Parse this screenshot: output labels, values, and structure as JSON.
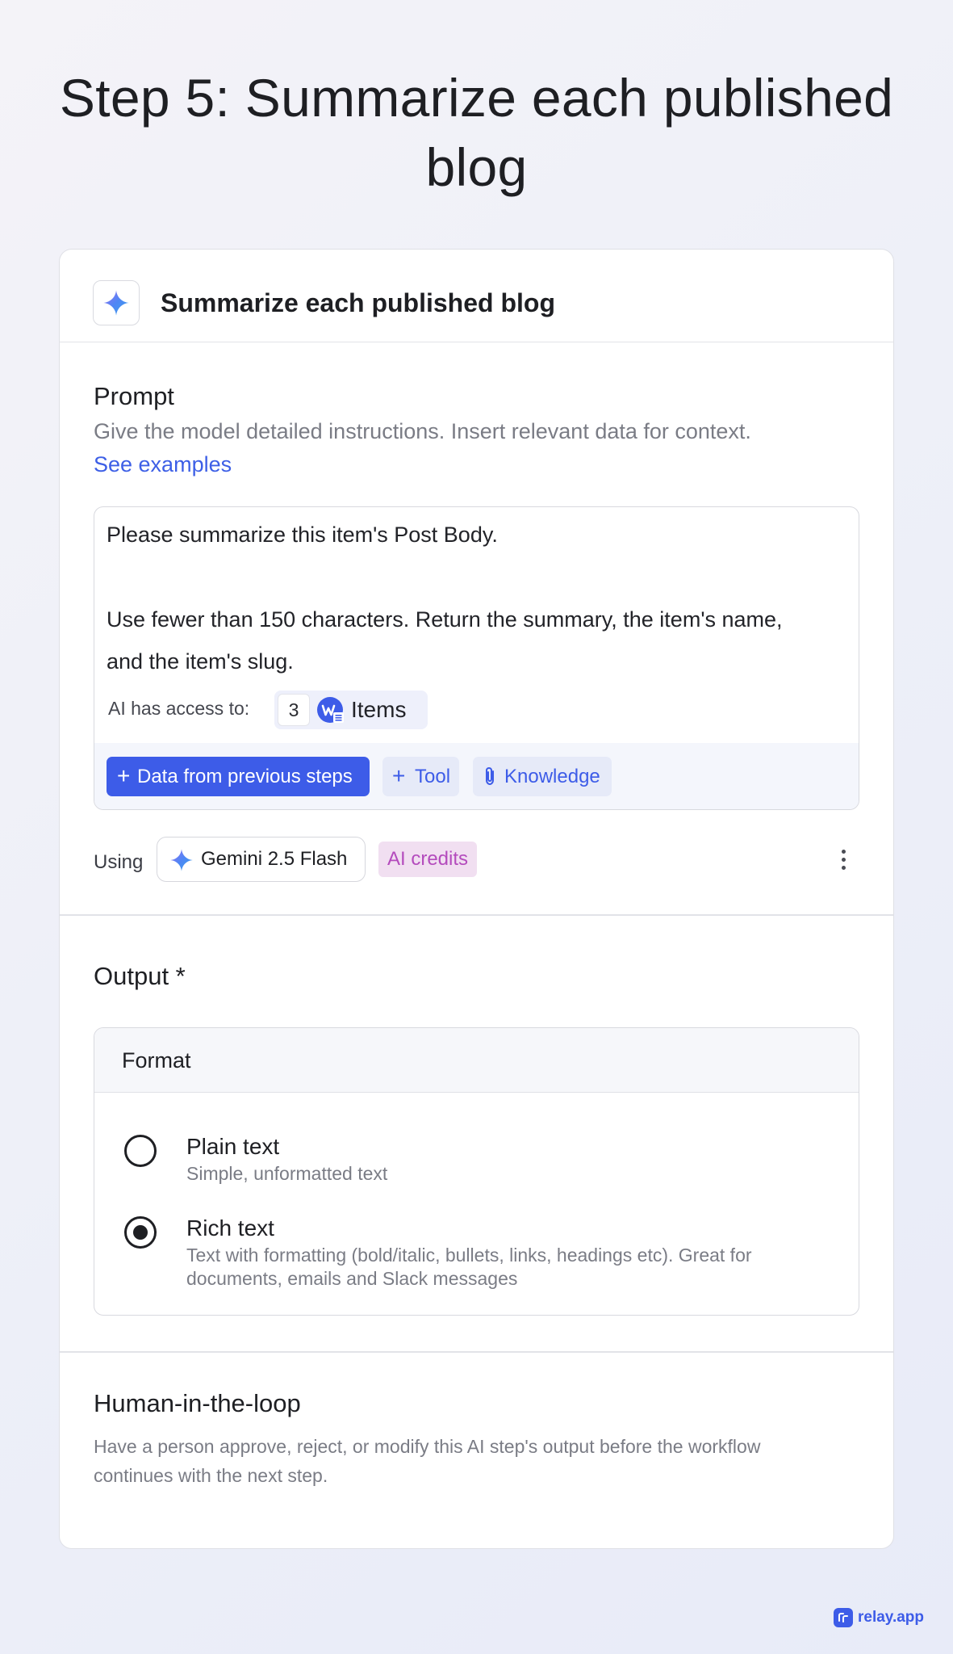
{
  "page_title": "Step 5: Summarize each published blog",
  "step": {
    "icon": "gemini-sparkle-icon",
    "title": "Summarize each published blog"
  },
  "prompt": {
    "label": "Prompt",
    "description": "Give the model detailed instructions. Insert relevant data for context.",
    "examples_link": "See examples",
    "text_lines": [
      "Please summarize this item's Post Body.",
      "",
      "Use fewer than 150 characters. Return the summary, the item's name,",
      "and the item's slug."
    ],
    "access_label": "AI has access to:",
    "access_count": "3",
    "access_app_icon": "webflow-icon",
    "access_items": "Items",
    "buttons": {
      "data": "Data from previous steps",
      "tool": "Tool",
      "knowledge": "Knowledge"
    }
  },
  "model": {
    "using_label": "Using",
    "name": "Gemini 2.5 Flash",
    "credits_badge": "AI credits"
  },
  "output": {
    "label": "Output *",
    "format_title": "Format",
    "options": [
      {
        "title": "Plain text",
        "description": "Simple, unformatted text",
        "checked": false
      },
      {
        "title": "Rich text",
        "description": "Text with formatting (bold/italic, bullets, links, headings etc). Great for documents, emails and Slack messages",
        "checked": true
      }
    ]
  },
  "hitl": {
    "title": "Human-in-the-loop",
    "description": "Have a person approve, reject, or modify this AI step's output before the workflow continues with the next step."
  },
  "brand": {
    "name": "relay.app"
  },
  "colors": {
    "accent": "#3d5ce8",
    "credits_text": "#b44bbd",
    "credits_bg": "#f1dff1",
    "muted_text": "#7a7c85"
  }
}
